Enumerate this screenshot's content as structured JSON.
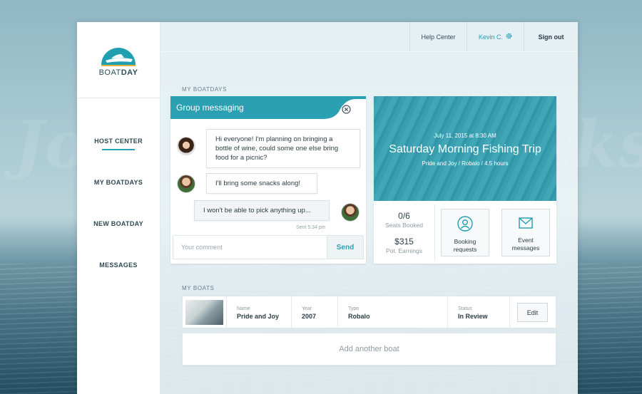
{
  "brand": {
    "logo_light": "BOAT",
    "logo_bold": "DAY",
    "accent": "#2aa0b2"
  },
  "topbar": {
    "help": "Help Center",
    "user": "Kevin C.",
    "signout": "Sign out"
  },
  "nav": {
    "items": [
      {
        "label": "HOST CENTER",
        "active": true
      },
      {
        "label": "MY BOATDAYS"
      },
      {
        "label": "NEW BOATDAY"
      },
      {
        "label": "MESSAGES"
      }
    ]
  },
  "sections": {
    "boatdays": "MY BOATDAYS",
    "boats": "MY BOATS"
  },
  "chat": {
    "title": "Group messaging",
    "messages": [
      {
        "text": "Hi everyone! I'm planning on bringing a bottle of wine, could some one else bring food for a picnic?"
      },
      {
        "text": "I'll bring some snacks along!"
      },
      {
        "text": "I won't be able to pick anything up..."
      }
    ],
    "sent_time": "Sent 5.34 pm",
    "input_placeholder": "Your comment",
    "send_label": "Send"
  },
  "trip": {
    "date": "July 11, 2015 at 8:30 AM",
    "title": "Saturday Morning Fishing Trip",
    "subtitle": "Pride and Joy / Robalo / 4.5 hours",
    "seats_value": "0/6",
    "seats_label": "Seats Booked",
    "earnings_value": "$315",
    "earnings_label": "Pot. Earnings",
    "booking_label_1": "Booking",
    "booking_label_2": "requests",
    "event_label_1": "Event",
    "event_label_2": "messages"
  },
  "boats": {
    "columns": {
      "name": "Name",
      "year": "Year",
      "type": "Type",
      "status": "Status"
    },
    "rows": [
      {
        "name": "Pride and Joy",
        "year": "2007",
        "type": "Robalo",
        "status": "In Review"
      }
    ],
    "edit_label": "Edit",
    "add_label": "Add another boat"
  }
}
